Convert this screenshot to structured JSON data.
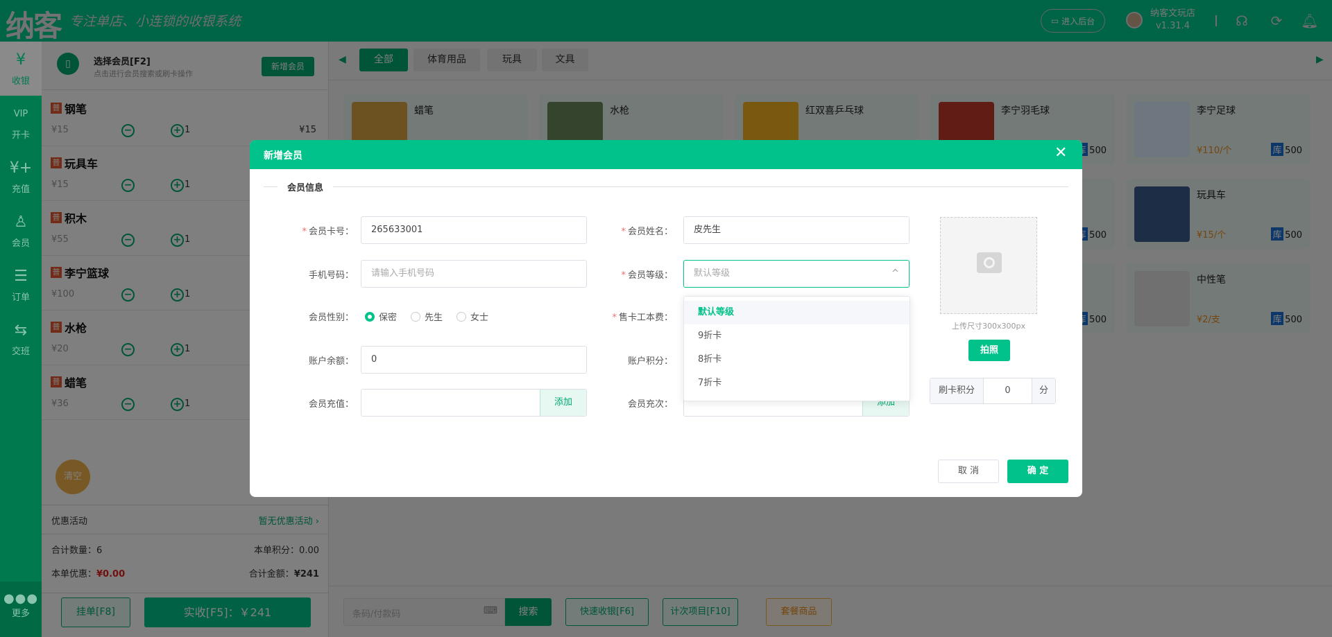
{
  "header": {
    "logo": "纳客",
    "slogan": "专注单店、小连锁的收银系统",
    "admin_button": "进入后台",
    "shop_name": "纳客文玩店",
    "version": "v1.31.4"
  },
  "nav": [
    {
      "label": "收银",
      "icon": "cashier-icon"
    },
    {
      "label": "开卡",
      "icon": "vip-card-icon"
    },
    {
      "label": "充值",
      "icon": "recharge-icon"
    },
    {
      "label": "会员",
      "icon": "member-icon"
    },
    {
      "label": "订单",
      "icon": "order-icon"
    },
    {
      "label": "交班",
      "icon": "shift-icon"
    }
  ],
  "nav_more": "更多",
  "member": {
    "title": "选择会员[F2]",
    "subtitle": "点击进行会员搜索或刷卡操作",
    "new_button": "新增会员"
  },
  "cart": {
    "badge": "普",
    "items": [
      {
        "name": "钢笔",
        "price": "¥15",
        "qty": "1",
        "subtotal": "¥15"
      },
      {
        "name": "玩具车",
        "price": "¥15",
        "qty": "1"
      },
      {
        "name": "积木",
        "price": "¥55",
        "qty": "1"
      },
      {
        "name": "李宁篮球",
        "price": "¥100",
        "qty": "1"
      },
      {
        "name": "水枪",
        "price": "¥20",
        "qty": "1"
      },
      {
        "name": "蜡笔",
        "price": "¥36",
        "qty": "1"
      }
    ]
  },
  "clear_label": "清空",
  "promo": {
    "label": "优惠活动",
    "value": "暂无优惠活动 ›"
  },
  "totals": {
    "qty_label": "合计数量：",
    "qty": "6",
    "points_label": "本单积分：",
    "points": "0.00",
    "discount_label": "本单优惠：",
    "discount": "¥0.00",
    "amount_label": "合计金额：",
    "amount": "¥241"
  },
  "actions": {
    "hold": "挂单[F8]",
    "pay": "实收[F5]：￥241"
  },
  "tabs": [
    "全部",
    "体育用品",
    "玩具",
    "文具"
  ],
  "products": [
    {
      "name": "蜡笔"
    },
    {
      "name": "水枪"
    },
    {
      "name": "红双喜乒乓球"
    },
    {
      "name": "李宁羽毛球",
      "stock": "500"
    },
    {
      "name": "李宁足球",
      "price": "¥110/个",
      "stock": "500"
    },
    {},
    {},
    {},
    {
      "stock": "500"
    },
    {
      "name": "玩具车",
      "price": "¥15/个",
      "stock": "500"
    },
    {},
    {},
    {},
    {
      "stock": "500"
    },
    {
      "name": "中性笔",
      "price": "¥2/支",
      "stock": "500"
    }
  ],
  "stock_badge": "库",
  "bottom": {
    "search_placeholder": "条码/付款码",
    "search": "搜索",
    "quick": "快速收银[F6]",
    "count": "计次项目[F10]",
    "package": "套餐商品"
  },
  "dialog": {
    "title": "新增会员",
    "section": "会员信息",
    "card_no_label": "会员卡号：",
    "card_no": "265633001",
    "name_label": "会员姓名：",
    "name": "皮先生",
    "phone_label": "手机号码：",
    "phone_placeholder": "请输入手机号码",
    "level_label": "会员等级：",
    "level_placeholder": "默认等级",
    "gender_label": "会员性别：",
    "genders": [
      "保密",
      "先生",
      "女士"
    ],
    "fee_label": "售卡工本费：",
    "balance_label": "账户余额：",
    "balance": "0",
    "points_label": "账户积分：",
    "recharge_label": "会员充值：",
    "count_label": "会员充次：",
    "add": "添加",
    "level_options": [
      "默认等级",
      "9折卡",
      "8折卡",
      "7折卡"
    ],
    "photo_hint": "上传尺寸300x300px",
    "photo_button": "拍照",
    "swipe_label": "刷卡积分",
    "swipe_value": "0",
    "swipe_unit": "分",
    "cancel": "取 消",
    "confirm": "确 定"
  },
  "colors": {
    "brand": "#00c28a",
    "nav": "#00794f",
    "price": "#e88a1a",
    "discount": "#e02020"
  }
}
